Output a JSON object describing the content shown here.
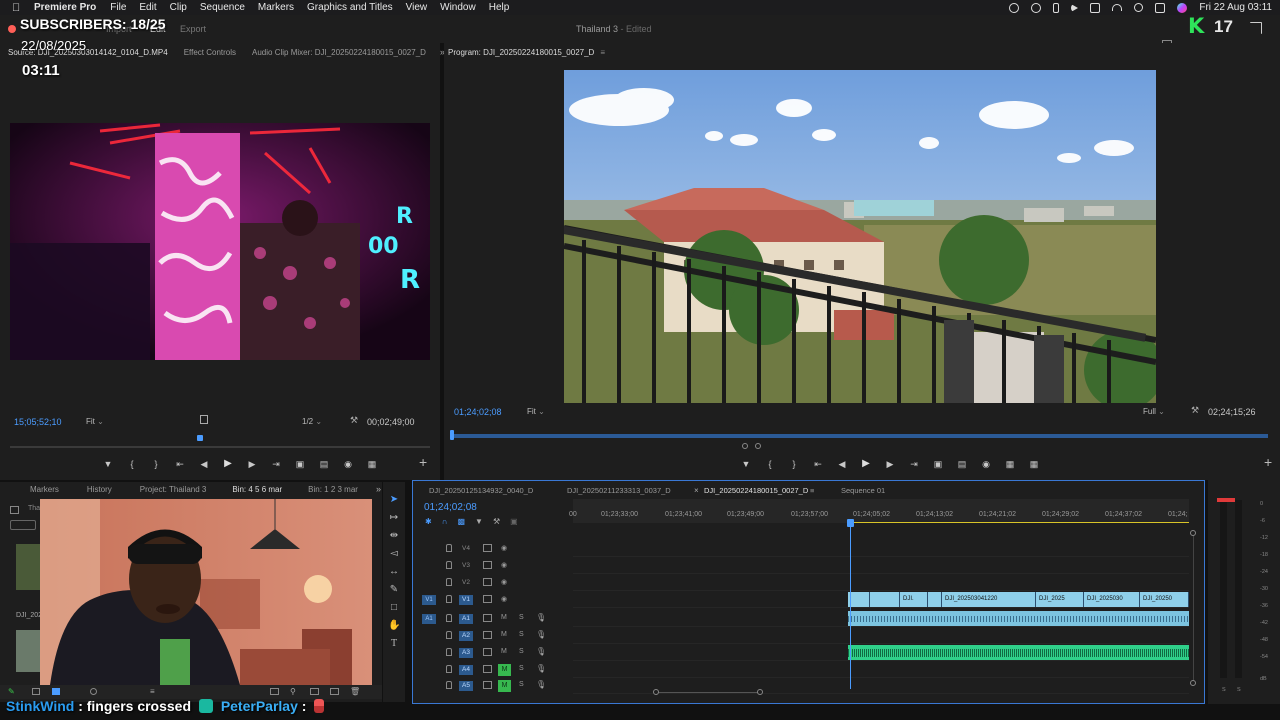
{
  "menubar": {
    "app_name": "Premiere Pro",
    "items": [
      "File",
      "Edit",
      "Clip",
      "Sequence",
      "Markers",
      "Graphics and Titles",
      "View",
      "Window",
      "Help"
    ],
    "datetime": "Fri 22 Aug  03:11"
  },
  "titlebar": {
    "workspaces": [
      "Import",
      "Edit",
      "Export"
    ],
    "active_workspace": "Edit",
    "doc_title": "Thailand 3",
    "doc_state": "- Edited",
    "kick_count": "17"
  },
  "overlay": {
    "subscribers": "SUBSCRIBERS: 18/25",
    "date": "22/08/2025",
    "time": "03:11"
  },
  "source": {
    "tabs": [
      "Source: DJI_20250303014142_0104_D.MP4",
      "Effect Controls",
      "Audio Clip Mixer: DJI_20250224180015_0027_D"
    ],
    "timecode": "15;05;52;10",
    "fit": "Fit",
    "resolution": "1/2",
    "duration": "00;02;49;00"
  },
  "program": {
    "title": "Program: DJI_20250224180015_0027_D",
    "timecode": "01;24;02;08",
    "fit": "Fit",
    "quality": "Full",
    "duration": "02;24;15;26"
  },
  "project": {
    "tabs": [
      "Markers",
      "History",
      "Project: Thailand 3",
      "Bin: 4 5 6 mar",
      "Bin: 1 2 3 mar"
    ],
    "active_tab": "Bin: 4 5 6 mar",
    "bin_prefix": "Tha",
    "item_label": "DJI_202"
  },
  "timeline": {
    "tabs": [
      "DJI_20250125134932_0040_D",
      "DJI_20250211233313_0037_D",
      "DJI_20250224180015_0027_D",
      "Sequence 01"
    ],
    "active_tab": "DJI_20250224180015_0027_D",
    "timecode": "01;24;02;08",
    "ruler_labels": [
      "00",
      "01;23;33;00",
      "01;23;41;00",
      "01;23;49;00",
      "01;23;57;00",
      "01;24;05;02",
      "01;24;13;02",
      "01;24;21;02",
      "01;24;29;02",
      "01;24;37;02",
      "01;24;"
    ],
    "video_tracks": [
      "V4",
      "V3",
      "V2",
      "V1"
    ],
    "audio_tracks": [
      "A1",
      "A2",
      "A3",
      "A4",
      "A5"
    ],
    "track_buttons": {
      "mute": "M",
      "solo": "S"
    },
    "v1_clips": [
      "DJI.",
      "DJI_202503041220",
      "DJI_2025",
      "DJI_2025030",
      "DJI_20250"
    ]
  },
  "meters": {
    "scale": [
      "0",
      "-6",
      "-12",
      "-18",
      "-24",
      "-30",
      "-36",
      "-42",
      "-48",
      "-54",
      "dB"
    ],
    "solo": [
      "S",
      "S"
    ]
  },
  "chat": {
    "user1": "StinkWind",
    "message1": ": fingers crossed",
    "user2": "PeterParlay",
    "message2": ":"
  },
  "colors": {
    "accent_blue": "#4b9cff",
    "timeline_border": "#3a78d4",
    "clip_video": "#8fd0ea",
    "clip_audio_green": "#2fd08a",
    "mute_green": "#37b84f",
    "kick_green": "#2ee35a"
  }
}
